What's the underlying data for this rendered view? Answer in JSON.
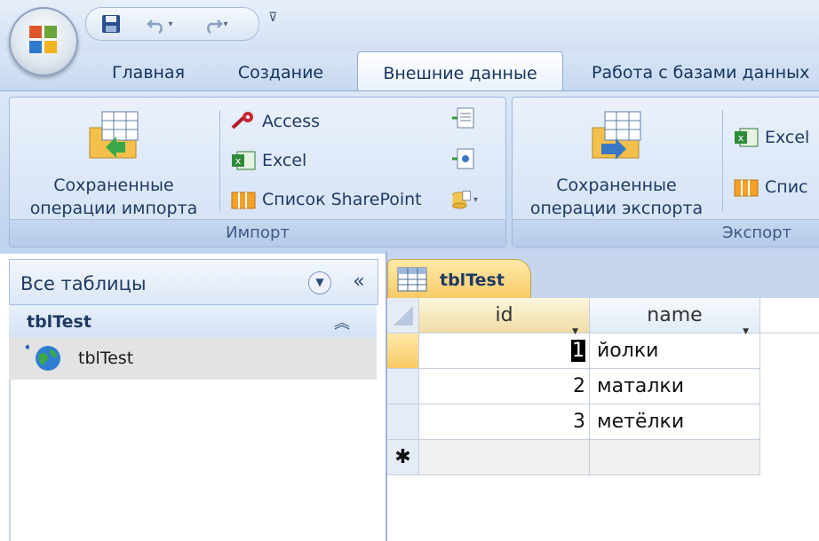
{
  "tabs": [
    {
      "label": "Главная"
    },
    {
      "label": "Создание"
    },
    {
      "label": "Внешние данные"
    },
    {
      "label": "Работа с базами данных"
    }
  ],
  "ribbon": {
    "import_group": {
      "saved_ops_line1": "Сохраненные",
      "saved_ops_line2": "операции импорта",
      "access": "Access",
      "excel": "Excel",
      "sharepoint": "Список SharePoint",
      "label": "Импорт"
    },
    "export_group": {
      "saved_ops_line1": "Сохраненные",
      "saved_ops_line2": "операции экспорта",
      "excel": "Excel",
      "sharepoint": "Спис",
      "label": "Экспорт"
    }
  },
  "nav": {
    "title": "Все таблицы",
    "group": "tblTest",
    "item": "tblTest"
  },
  "document": {
    "tab": "tblTest",
    "columns": [
      "id",
      "name"
    ],
    "rows": [
      {
        "id": "1",
        "name": "йолки"
      },
      {
        "id": "2",
        "name": "маталки"
      },
      {
        "id": "3",
        "name": "метёлки"
      }
    ],
    "new_row_marker": "✱"
  },
  "colors": {
    "accent_tab": "#f7c963",
    "ribbon_bg": "#c7d9f1",
    "text": "#1f3a63"
  }
}
